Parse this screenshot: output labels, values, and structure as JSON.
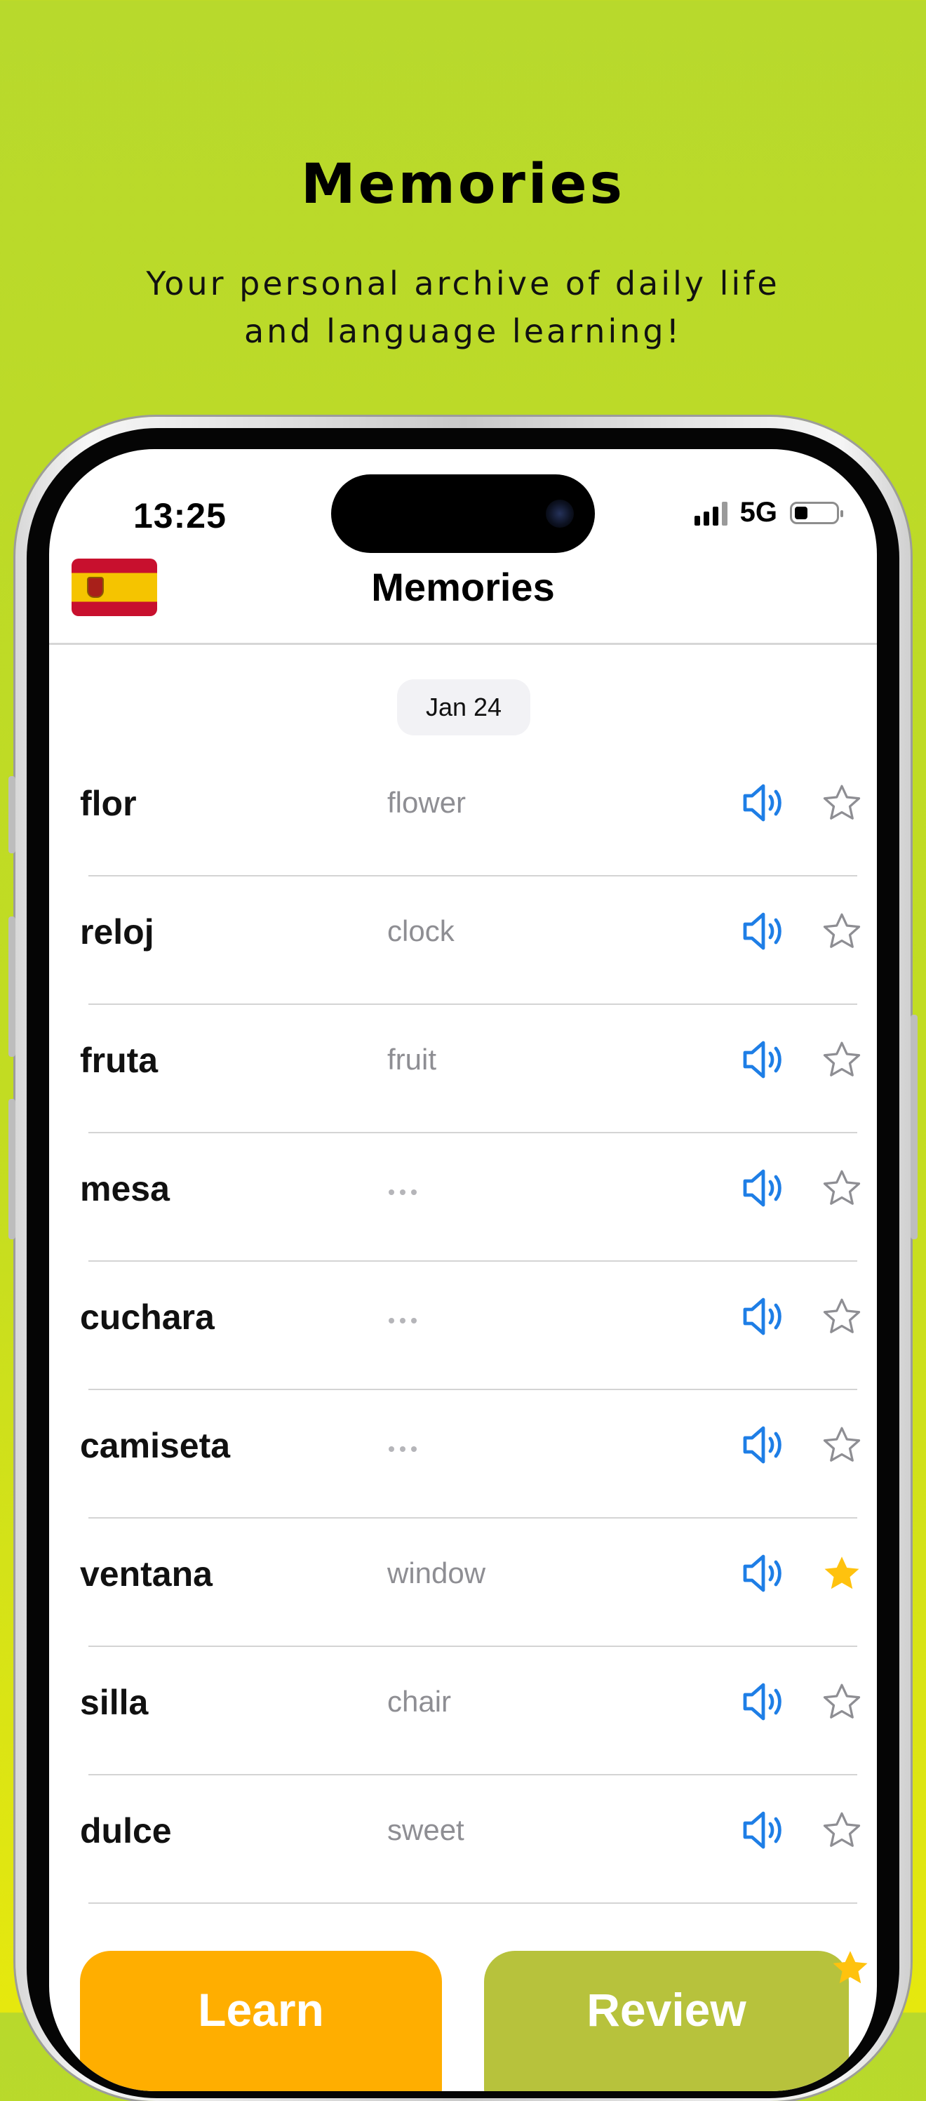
{
  "promo": {
    "title": "Memories",
    "subtitle": "Your personal archive of daily life and language learning!"
  },
  "status_bar": {
    "time": "13:25",
    "network": "5G"
  },
  "header": {
    "title": "Memories",
    "language_flag": "spain-flag-icon"
  },
  "date_label": "Jan 24",
  "colors": {
    "background_top": "#b8d92c",
    "background_bottom": "#e6e80e",
    "speaker_blue": "#1e7ee6",
    "star_filled": "#ffc20e",
    "star_outline": "#8e8e93",
    "learn_button": "#ffae00",
    "review_button": "#b7c23c"
  },
  "words": [
    {
      "word": "flor",
      "translation": "flower",
      "starred": false
    },
    {
      "word": "reloj",
      "translation": "clock",
      "starred": false
    },
    {
      "word": "fruta",
      "translation": "fruit",
      "starred": false
    },
    {
      "word": "mesa",
      "translation": null,
      "starred": false
    },
    {
      "word": "cuchara",
      "translation": null,
      "starred": false
    },
    {
      "word": "camiseta",
      "translation": null,
      "starred": false
    },
    {
      "word": "ventana",
      "translation": "window",
      "starred": true
    },
    {
      "word": "silla",
      "translation": "chair",
      "starred": false
    },
    {
      "word": "dulce",
      "translation": "sweet",
      "starred": false
    }
  ],
  "actions": {
    "learn_label": "Learn",
    "review_label": "Review"
  }
}
